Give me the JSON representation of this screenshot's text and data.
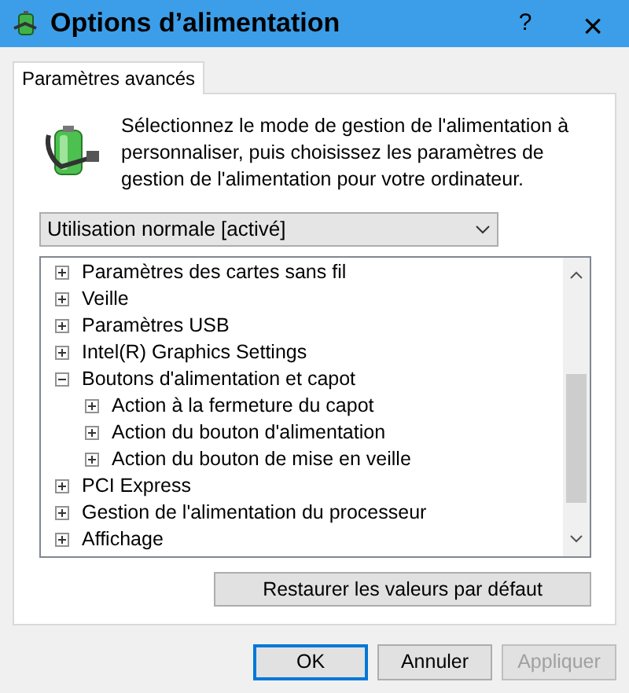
{
  "window": {
    "title": "Options d’alimentation",
    "help": "?",
    "close": "×"
  },
  "tabs": [
    {
      "label": "Paramètres avancés",
      "selected": true
    }
  ],
  "description": "Sélectionnez le mode de gestion de l'alimentation à personnaliser, puis choisissez les paramètres de gestion de l'alimentation pour votre ordinateur.",
  "plan_dropdown": {
    "value": "Utilisation normale [activé]"
  },
  "tree": [
    {
      "label": "Paramètres des cartes sans fil",
      "expanded": false
    },
    {
      "label": "Veille",
      "expanded": false
    },
    {
      "label": "Paramètres USB",
      "expanded": false
    },
    {
      "label": "Intel(R) Graphics Settings",
      "expanded": false
    },
    {
      "label": "Boutons d'alimentation et capot",
      "expanded": true,
      "children": [
        {
          "label": "Action à la fermeture du capot",
          "expanded": false
        },
        {
          "label": "Action du bouton d'alimentation",
          "expanded": false
        },
        {
          "label": "Action du bouton de mise en veille",
          "expanded": false
        }
      ]
    },
    {
      "label": "PCI Express",
      "expanded": false
    },
    {
      "label": "Gestion de l'alimentation du processeur",
      "expanded": false
    },
    {
      "label": "Affichage",
      "expanded": false
    }
  ],
  "restore_button": "Restaurer les valeurs par défaut",
  "buttons": [
    {
      "label": "OK",
      "kind": "default",
      "disabled": false
    },
    {
      "label": "Annuler",
      "kind": "normal",
      "disabled": false
    },
    {
      "label": "Appliquer",
      "kind": "normal",
      "disabled": true
    }
  ]
}
